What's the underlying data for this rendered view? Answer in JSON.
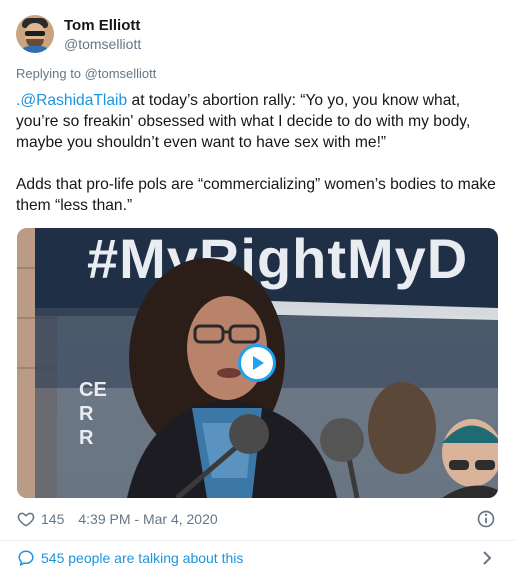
{
  "tweet": {
    "author_name": "Tom Elliott",
    "author_handle": "@tomselliott",
    "reply_prefix": "Replying to ",
    "reply_handle": "@tomselliott",
    "text_lead": ".",
    "text_mention": "@RashidaTlaib",
    "text_rest": " at today’s abortion rally: “Yo yo, you know what, you’re so freakin' obsessed with what I decide to do with my body, maybe you shouldn’t even want to have sex with me!”",
    "text_para2": "Adds that pro-life pols are “commercializing” women’s bodies to make them “less than.”"
  },
  "media": {
    "banner_text": "#MyRightMyD",
    "sign_fragment_lines": [
      "CE",
      "R",
      "R"
    ]
  },
  "meta": {
    "like_count": "145",
    "timestamp": "4:39 PM - Mar 4, 2020"
  },
  "footer": {
    "talking_text": "545 people are talking about this"
  },
  "colors": {
    "link": "#1b95e0",
    "secondary_text": "#657786",
    "primary_text": "#14171a",
    "banner_dark": "#1f2f45",
    "play_ring": "#1da1f2"
  },
  "icons": [
    "heart-icon",
    "info-icon",
    "speech-bubble-icon",
    "chevron-right-icon",
    "play-icon"
  ]
}
